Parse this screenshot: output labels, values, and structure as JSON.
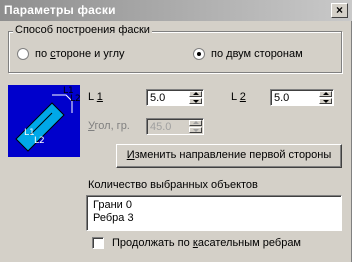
{
  "window": {
    "title": "Параметры фаски",
    "close": "×"
  },
  "method_group": {
    "legend": "Способ построения фаски",
    "options": [
      {
        "pre": "по ",
        "accel": "с",
        "post": "тороне и углу",
        "checked": false
      },
      {
        "pre": "по ",
        "accel": "д",
        "post": "вум сторонам",
        "checked": true
      }
    ]
  },
  "preview": {
    "labels": [
      "L1",
      "L2",
      "L1",
      "L2"
    ],
    "colors": {
      "face": "#00a8e8",
      "back": "#0000cc"
    }
  },
  "params": {
    "l1": {
      "label": "L",
      "accel": "1",
      "value": "5.0"
    },
    "l2": {
      "label": "L",
      "accel": "2",
      "value": "5.0"
    },
    "angle": {
      "accel": "У",
      "label": "гол, гр.",
      "value": "45.0",
      "disabled": true
    }
  },
  "change_direction_button": {
    "accel": "И",
    "label": "зменить направление первой стороны"
  },
  "selected_objects": {
    "title": "Количество выбранных объектов",
    "items": [
      "Грани 0",
      "Ребра 3"
    ]
  },
  "tangent_checkbox": {
    "pre": "Продолжать по ",
    "accel": "к",
    "post": "асательным ребрам",
    "checked": false
  }
}
